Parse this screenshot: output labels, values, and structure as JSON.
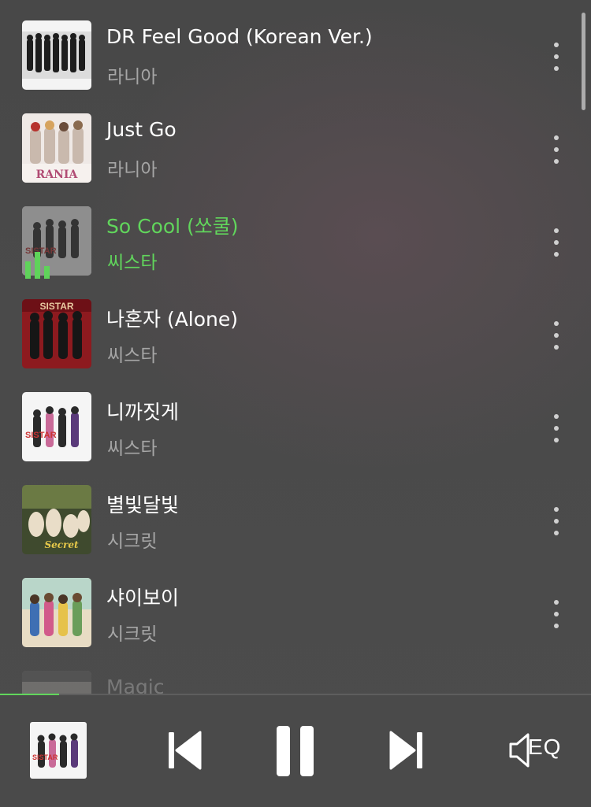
{
  "tracks": [
    {
      "title": "DR Feel Good (Korean Ver.)",
      "artist": "라니아",
      "active": false
    },
    {
      "title": "Just Go",
      "artist": "라니아",
      "active": false
    },
    {
      "title": "So Cool (쏘쿨)",
      "artist": "씨스타",
      "active": true
    },
    {
      "title": "나혼자 (Alone)",
      "artist": "씨스타",
      "active": false
    },
    {
      "title": "니까짓게",
      "artist": "씨스타",
      "active": false
    },
    {
      "title": "별빛달빛",
      "artist": "시크릿",
      "active": false
    },
    {
      "title": "샤이보이",
      "artist": "시크릿",
      "active": false
    },
    {
      "title": "Magic",
      "artist": "",
      "active": false
    }
  ],
  "player": {
    "progress": 0.1,
    "eq_label": "EQ"
  },
  "colors": {
    "accent": "#61d65c",
    "background": "#4a4a4a",
    "subtitle": "#a6a6a6"
  },
  "icons": {
    "previous": "skip-previous-icon",
    "pause": "pause-icon",
    "next": "skip-next-icon",
    "eq": "speaker-eq-icon",
    "more": "more-vertical-icon"
  }
}
